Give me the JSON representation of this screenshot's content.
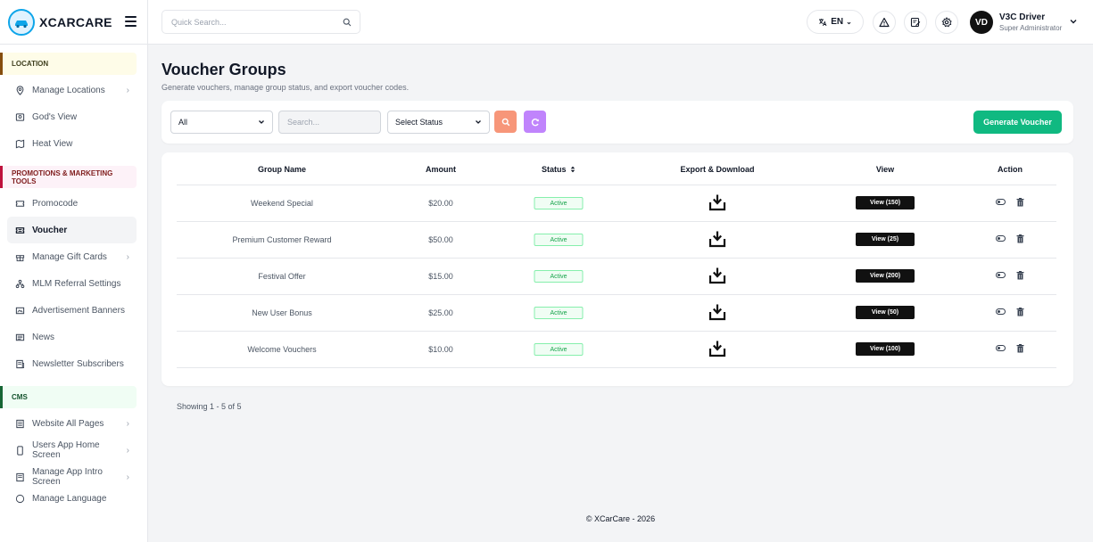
{
  "brand": {
    "name": "XCARCARE"
  },
  "header": {
    "search_placeholder": "Quick Search...",
    "language": "EN",
    "user": {
      "initials": "VD",
      "name": "V3C Driver",
      "role": "Super Administrator"
    }
  },
  "sidebar": {
    "location": {
      "title": "LOCATION",
      "items": [
        {
          "label": "Manage Locations",
          "icon": "map-pin-icon",
          "has_submenu": true
        },
        {
          "label": "God's View",
          "icon": "map-icon",
          "has_submenu": false
        },
        {
          "label": "Heat View",
          "icon": "heat-map-icon",
          "has_submenu": false
        }
      ]
    },
    "promotions": {
      "title": "PROMOTIONS & MARKETING TOOLS",
      "items": [
        {
          "label": "Promocode",
          "icon": "ticket-icon",
          "has_submenu": false
        },
        {
          "label": "Voucher",
          "icon": "voucher-icon",
          "has_submenu": false,
          "active": true
        },
        {
          "label": "Manage Gift Cards",
          "icon": "gift-icon",
          "has_submenu": true
        },
        {
          "label": "MLM Referral Settings",
          "icon": "network-icon",
          "has_submenu": false
        },
        {
          "label": "Advertisement Banners",
          "icon": "banner-icon",
          "has_submenu": false
        },
        {
          "label": "News",
          "icon": "newspaper-icon",
          "has_submenu": false
        },
        {
          "label": "Newsletter Subscribers",
          "icon": "newsletter-icon",
          "has_submenu": false
        }
      ]
    },
    "cms": {
      "title": "CMS",
      "items": [
        {
          "label": "Website All Pages",
          "icon": "pages-icon",
          "has_submenu": true
        },
        {
          "label": "Users App Home Screen",
          "icon": "phone-icon",
          "has_submenu": true
        },
        {
          "label": "Manage App Intro Screen",
          "icon": "intro-icon",
          "has_submenu": true
        },
        {
          "label": "Manage Language",
          "icon": "language-icon",
          "has_submenu": false
        }
      ]
    }
  },
  "page": {
    "title": "Voucher Groups",
    "subtitle": "Generate vouchers, manage group status, and export voucher codes."
  },
  "filters": {
    "type_value": "All",
    "search_placeholder": "Search...",
    "status_value": "Select Status",
    "generate_label": "Generate Voucher"
  },
  "table": {
    "columns": {
      "group_name": "Group Name",
      "amount": "Amount",
      "status": "Status",
      "export": "Export & Download",
      "view": "View",
      "action": "Action"
    },
    "rows": [
      {
        "group_name": "Weekend Special",
        "amount": "$20.00",
        "status": "Active",
        "view": "View (150)"
      },
      {
        "group_name": "Premium Customer Reward",
        "amount": "$50.00",
        "status": "Active",
        "view": "View (25)"
      },
      {
        "group_name": "Festival Offer",
        "amount": "$15.00",
        "status": "Active",
        "view": "View (200)"
      },
      {
        "group_name": "New User Bonus",
        "amount": "$25.00",
        "status": "Active",
        "view": "View (50)"
      },
      {
        "group_name": "Welcome Vouchers",
        "amount": "$10.00",
        "status": "Active",
        "view": "View (100)"
      }
    ]
  },
  "pagination": {
    "showing": "Showing 1 - 5 of 5"
  },
  "footer": {
    "text": "© XCarCare - 2026"
  },
  "colors": {
    "accent_green": "#10b981",
    "search_orange": "#f79679",
    "refresh_purple": "#c084fc",
    "status_green": "#16a34a"
  }
}
